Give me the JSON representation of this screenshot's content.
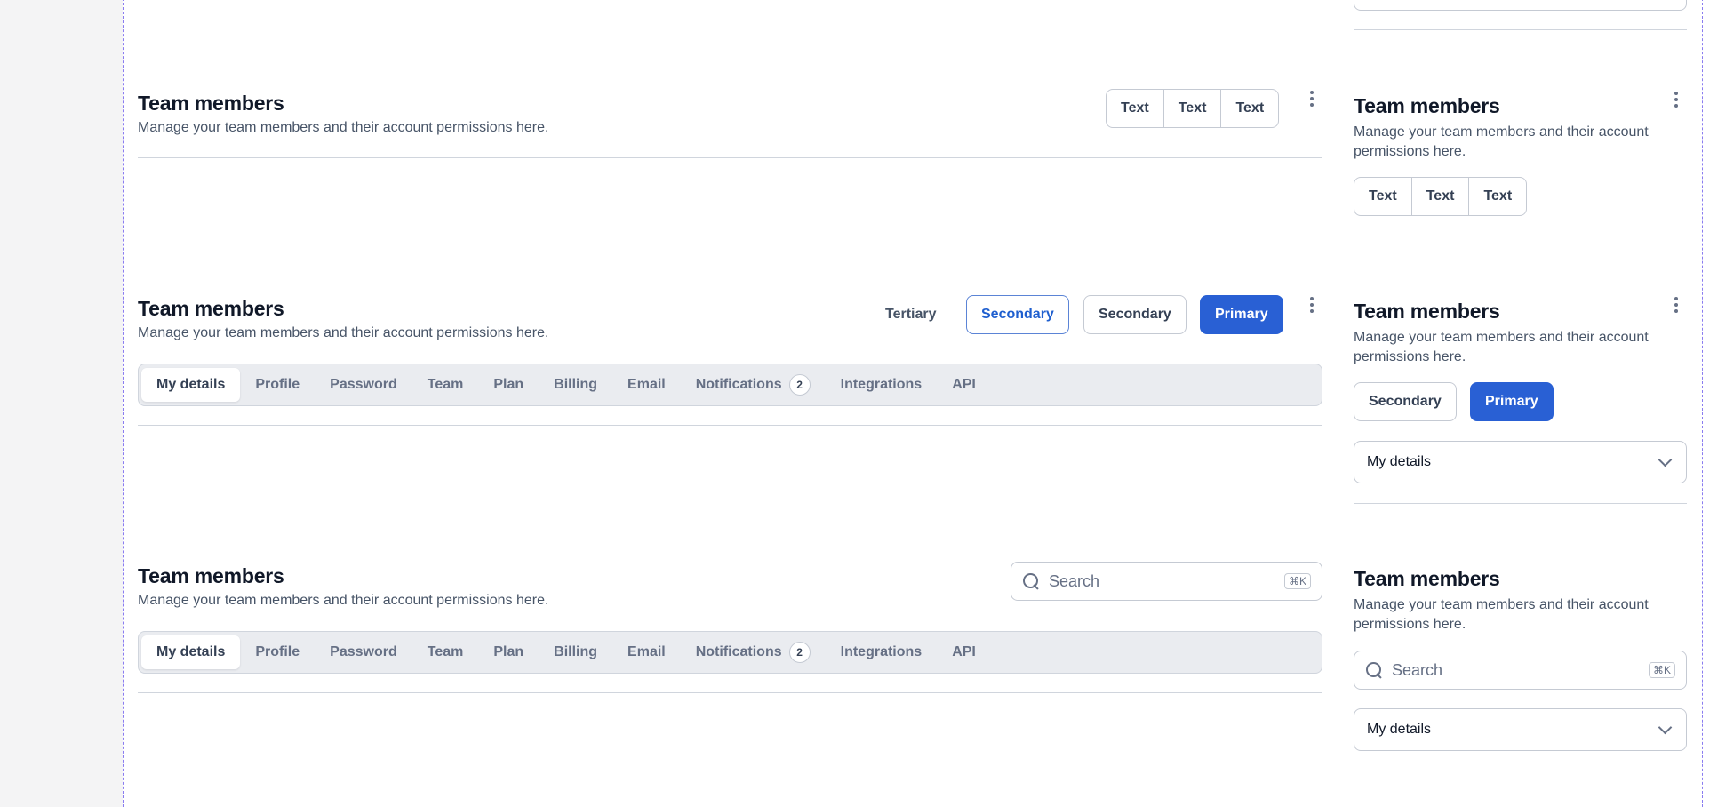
{
  "sections": [
    {
      "title": "Team members",
      "subtitle": "Manage your team members and their account permissions here.",
      "button_group": [
        "Text",
        "Text",
        "Text"
      ]
    },
    {
      "title": "Team members",
      "subtitle": "Manage your team members and their account permissions here.",
      "actions": {
        "tertiary": "Tertiary",
        "secondary_color": "Secondary",
        "secondary": "Secondary",
        "primary": "Primary"
      },
      "tabs": [
        "My details",
        "Profile",
        "Password",
        "Team",
        "Plan",
        "Billing",
        "Email",
        "Notifications",
        "Integrations",
        "API"
      ],
      "notifications_badge": "2"
    },
    {
      "title": "Team members",
      "subtitle": "Manage your team members and their account permissions here.",
      "search": {
        "placeholder": "Search",
        "shortcut": "⌘K"
      },
      "tabs": [
        "My details",
        "Profile",
        "Password",
        "Team",
        "Plan",
        "Billing",
        "Email",
        "Notifications",
        "Integrations",
        "API"
      ],
      "notifications_badge": "2"
    }
  ],
  "mobile": [
    {
      "title": "Team members",
      "subtitle": "Manage your team members and their account permissions here.",
      "button_group": [
        "Text",
        "Text",
        "Text"
      ]
    },
    {
      "title": "Team members",
      "subtitle": "Manage your team members and their account permissions here.",
      "secondary": "Secondary",
      "primary": "Primary",
      "select_value": "My details"
    },
    {
      "title": "Team members",
      "subtitle": "Manage your team members and their account permissions here.",
      "search": {
        "placeholder": "Search",
        "shortcut": "⌘K"
      },
      "select_value": "My details"
    }
  ],
  "colors": {
    "primary": "#2960d4",
    "frame_dash": "#8a7cf0",
    "text_primary": "#101828",
    "text_secondary": "#475467"
  }
}
